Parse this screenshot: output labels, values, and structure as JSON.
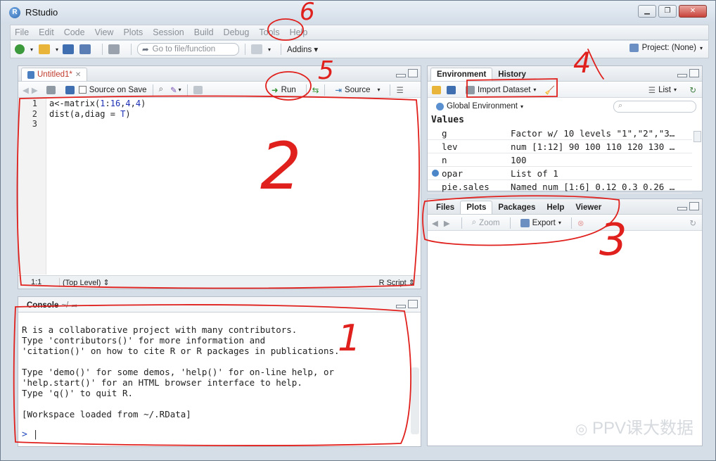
{
  "window": {
    "title": "RStudio"
  },
  "menu": [
    "File",
    "Edit",
    "Code",
    "View",
    "Plots",
    "Session",
    "Build",
    "Debug",
    "Tools",
    "Help"
  ],
  "toolbar": {
    "goto_placeholder": "Go to file/function",
    "addins_label": "Addins",
    "project_label": "Project: (None)"
  },
  "editor": {
    "tab_label": "Untitled1*",
    "source_on_save_label": "Source on Save",
    "run_label": "Run",
    "source_label": "Source",
    "line_numbers": [
      "1",
      "2",
      "3"
    ],
    "code_lines": [
      "a<-matrix(1:16,4,4)",
      "dist(a,diag = T)",
      ""
    ],
    "cursor_pos": "1:1",
    "scope": "(Top Level)",
    "filetype": "R Script"
  },
  "environment": {
    "tabs": [
      "Environment",
      "History"
    ],
    "import_label": "Import Dataset",
    "list_label": "List",
    "scope_label": "Global Environment",
    "section_label": "Values",
    "rows": [
      {
        "name": "g",
        "value": "Factor w/ 10 levels \"1\",\"2\",\"3…"
      },
      {
        "name": "lev",
        "value": "num [1:12] 90 100 110 120 130 …"
      },
      {
        "name": "n",
        "value": "100"
      },
      {
        "name": "opar",
        "value": "List of 1"
      },
      {
        "name": "pie.sales",
        "value": "Named num [1:6] 0.12 0.3 0.26 …"
      }
    ]
  },
  "files": {
    "tabs": [
      "Files",
      "Plots",
      "Packages",
      "Help",
      "Viewer"
    ],
    "zoom_label": "Zoom",
    "export_label": "Export"
  },
  "console": {
    "tab_label": "Console",
    "path": "~/",
    "lines": [
      "R is a collaborative project with many contributors.",
      "Type 'contributors()' for more information and",
      "'citation()' on how to cite R or R packages in publications.",
      "",
      "Type 'demo()' for some demos, 'help()' for on-line help, or",
      "'help.start()' for an HTML browser interface to help.",
      "Type 'q()' to quit R.",
      "",
      "[Workspace loaded from ~/.RData]"
    ],
    "prompt": ">"
  },
  "watermark": "PPV课大数据",
  "annotations": [
    "1",
    "2",
    "3",
    "4",
    "5",
    "6"
  ]
}
